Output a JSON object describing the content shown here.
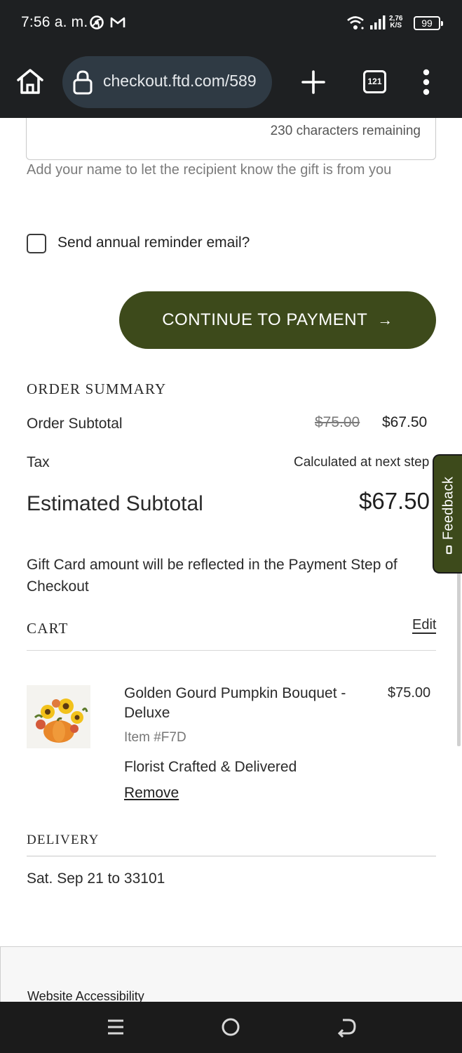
{
  "status_bar": {
    "time": "7:56 a. m.",
    "net_speed_value": "2,76",
    "net_speed_unit": "K/S",
    "battery": "99",
    "icons": [
      "chrome-icon",
      "gmail-icon",
      "wifi-icon",
      "signal-icon"
    ]
  },
  "browser": {
    "url": "checkout.ftd.com/589",
    "tab_count": "121",
    "icons": [
      "home-icon",
      "lock-icon",
      "plus-icon",
      "tabs-icon",
      "more-vert-icon"
    ]
  },
  "form": {
    "chars_remaining": "230 characters remaining",
    "helper_text": "Add your name to let the recipient know the gift is from you",
    "reminder_label": "Send annual reminder email?",
    "reminder_checked": false,
    "continue_label": "CONTINUE TO PAYMENT",
    "continue_arrow": "→"
  },
  "order_summary": {
    "heading": "ORDER SUMMARY",
    "subtotal_label": "Order Subtotal",
    "subtotal_original": "$75.00",
    "subtotal_discounted": "$67.50",
    "tax_label": "Tax",
    "tax_value": "Calculated at next step",
    "estimated_label": "Estimated Subtotal",
    "estimated_value": "$67.50",
    "gift_card_note": "Gift Card amount will be reflected in the Payment Step of Checkout"
  },
  "cart": {
    "heading": "CART",
    "edit_label": "Edit",
    "items": [
      {
        "name": "Golden Gourd Pumpkin Bouquet - Deluxe",
        "price": "$75.00",
        "sku": "Item #F7D",
        "service": "Florist Crafted & Delivered",
        "remove_label": "Remove"
      }
    ]
  },
  "delivery": {
    "heading": "DELIVERY",
    "info": "Sat. Sep 21 to 33101"
  },
  "footer": {
    "accessibility_link": "Website Accessibility"
  },
  "feedback": {
    "label": "Feedback"
  },
  "colors": {
    "brand_green": "#3d4a1b",
    "browser_chrome": "#1e2022",
    "url_pill": "#2f3a44"
  }
}
